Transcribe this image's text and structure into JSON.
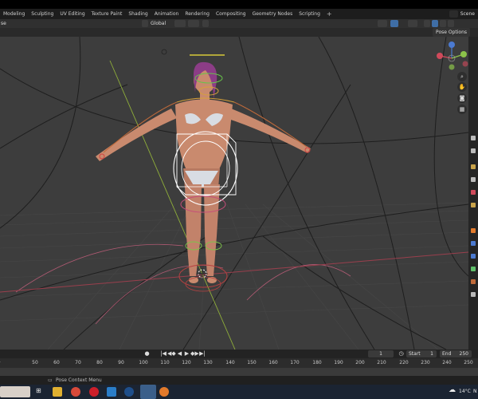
{
  "workspace_tabs": [
    "Modeling",
    "Sculpting",
    "UV Editing",
    "Texture Paint",
    "Shading",
    "Animation",
    "Rendering",
    "Compositing",
    "Geometry Nodes",
    "Scripting",
    "+"
  ],
  "scene": {
    "label": "Scene"
  },
  "header": {
    "left_fragment": "se",
    "orientation": "Global",
    "pose_options": "Pose Options"
  },
  "timeline": {
    "current_frame": "1",
    "start_label": "Start",
    "start_value": "1",
    "end_label": "End",
    "end_value": "250",
    "ruler_ticks": [
      "50",
      "60",
      "70",
      "80",
      "90",
      "100",
      "110",
      "120",
      "130",
      "140",
      "150",
      "160",
      "170",
      "180",
      "190",
      "200",
      "210",
      "220",
      "230",
      "240",
      "250"
    ]
  },
  "status": {
    "context_menu": "Pose Context Menu"
  },
  "taskbar": {
    "weather": "14°C",
    "weather_suffix": "N"
  },
  "colors": {
    "viewport_bg": "#3d3d3d",
    "grid": "#4a4a4a",
    "x_axis": "#9a3f4d",
    "y_axis": "#8fae3a",
    "accent_blue": "#3f6ea6",
    "skin": "#c98a6e"
  },
  "icons": [
    "search-icon",
    "hand-icon",
    "camera-icon",
    "grid-icon",
    "play-icon",
    "clock-icon",
    "cloud-icon"
  ]
}
